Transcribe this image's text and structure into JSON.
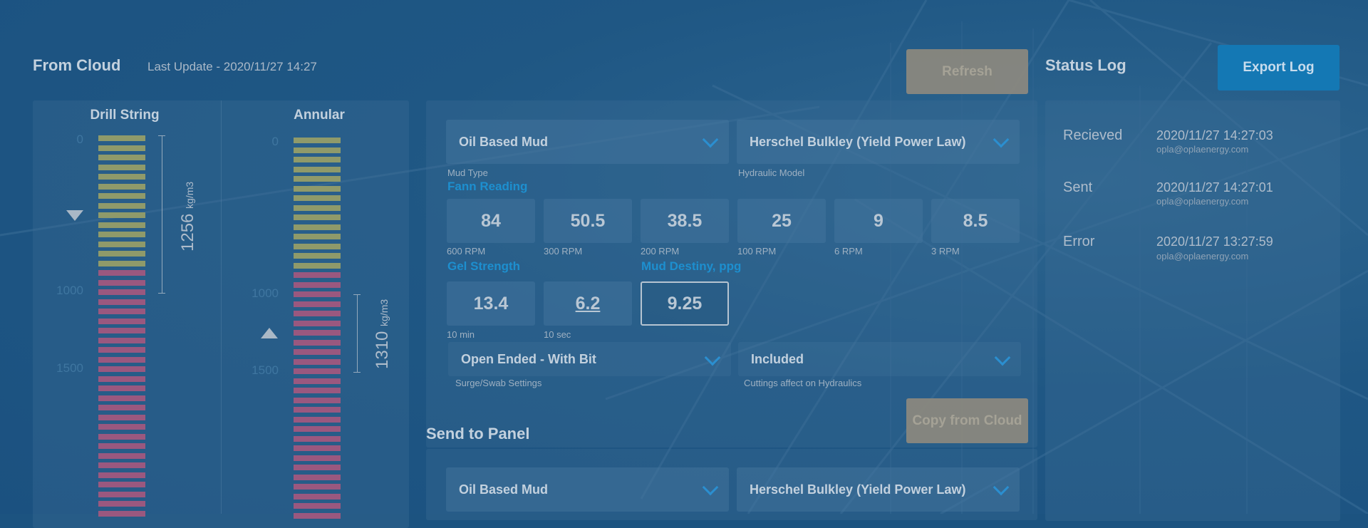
{
  "cloud": {
    "title": "From Cloud",
    "last_update": "Last Update - 2020/11/27 14:27",
    "refresh_label": "Refresh"
  },
  "status": {
    "title": "Status Log",
    "export_label": "Export Log",
    "entries": [
      {
        "name": "Recieved",
        "time": "2020/11/27 14:27:03",
        "email": "opla@oplaenergy.com"
      },
      {
        "name": "Sent",
        "time": "2020/11/27 14:27:01",
        "email": "opla@oplaenergy.com"
      },
      {
        "name": "Error",
        "time": "2020/11/27 13:27:59",
        "email": "opla@oplaenergy.com"
      }
    ]
  },
  "gauges": {
    "drill_title": "Drill String",
    "annular_title": "Annular",
    "drill_ticks": [
      "0",
      "1000",
      "1500"
    ],
    "annular_ticks": [
      "0",
      "1000",
      "1500"
    ],
    "drill_value": "1256",
    "annular_value": "1310",
    "unit": "kg/m3"
  },
  "form": {
    "mud_type": {
      "value": "Oil Based Mud",
      "label": "Mud Type"
    },
    "hydraulic_model": {
      "value": "Herschel Bulkley (Yield Power Law)",
      "label": "Hydraulic Model"
    },
    "fann_title": "Fann Reading",
    "fann": [
      {
        "value": "84",
        "label": "600 RPM"
      },
      {
        "value": "50.5",
        "label": "300 RPM"
      },
      {
        "value": "38.5",
        "label": "200 RPM"
      },
      {
        "value": "25",
        "label": "100 RPM"
      },
      {
        "value": "9",
        "label": "6 RPM"
      },
      {
        "value": "8.5",
        "label": "3 RPM"
      }
    ],
    "gel_title": "Gel Strength",
    "gel": [
      {
        "value": "13.4",
        "label": "10 min"
      },
      {
        "value": "6.2",
        "label": "10 sec"
      }
    ],
    "density_title": "Mud Destiny, ppg",
    "density_value": "9.25",
    "surge": {
      "value": "Open Ended - With Bit",
      "label": "Surge/Swab Settings"
    },
    "cuttings": {
      "value": "Included",
      "label": "Cuttings affect on Hydraulics"
    },
    "copy_label": "Copy from Cloud"
  },
  "panel": {
    "title": "Send to Panel",
    "mud_type": "Oil Based Mud",
    "hydraulic_model": "Herschel Bulkley (Yield Power Law)"
  },
  "colors": {
    "accent": "#1d8fcf",
    "bar_green": "#8f9a6a",
    "bar_pink": "#9a587f"
  }
}
